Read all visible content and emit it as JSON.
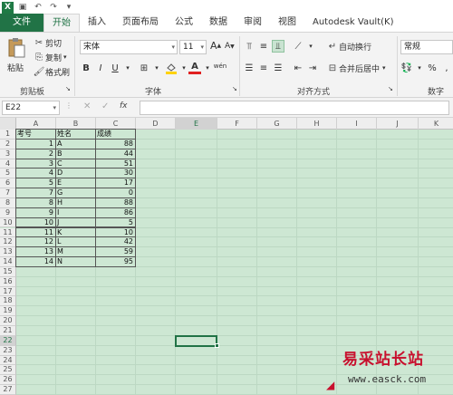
{
  "app": {
    "icon": "excel-app-icon",
    "accent": "#217346"
  },
  "quick_access": [
    {
      "name": "save-icon",
      "glyph": "▣"
    },
    {
      "name": "undo-icon",
      "glyph": "↶"
    },
    {
      "name": "redo-icon",
      "glyph": "↷"
    },
    {
      "name": "customize-qat-icon",
      "glyph": "▾"
    }
  ],
  "tabs": [
    "文件",
    "开始",
    "插入",
    "页面布局",
    "公式",
    "数据",
    "审阅",
    "视图",
    "Autodesk Vault(K)"
  ],
  "active_tab": "开始",
  "ribbon": {
    "clipboard": {
      "paste": "粘贴",
      "cut": "剪切",
      "copy": "复制",
      "format_painter": "格式刷",
      "group": "剪贴板"
    },
    "font": {
      "font_name": "宋体",
      "font_size": "11",
      "bold": "B",
      "italic": "I",
      "underline": "U",
      "font_color_letter": "A",
      "grow": "A",
      "shrink": "A",
      "wen": "wén",
      "group": "字体"
    },
    "alignment": {
      "wrap_text": "自动换行",
      "merge_center": "合并后居中",
      "group": "对齐方式"
    },
    "number": {
      "format": "常规",
      "percent": "%",
      "group": "数字"
    }
  },
  "formula_bar": {
    "name_box": "E22",
    "fx": "fx"
  },
  "columns": [
    "A",
    "B",
    "C",
    "D",
    "E",
    "F",
    "G",
    "H",
    "I",
    "J",
    "K"
  ],
  "rows": [
    "1",
    "2",
    "3",
    "4",
    "5",
    "6",
    "7",
    "8",
    "9",
    "10",
    "11",
    "12",
    "13",
    "14",
    "15",
    "16",
    "17",
    "18",
    "19",
    "20",
    "21",
    "22",
    "23",
    "24",
    "25",
    "26",
    "27"
  ],
  "table": {
    "headers": [
      "考号",
      "姓名",
      "成绩"
    ],
    "rows": [
      [
        "1",
        "A",
        "88"
      ],
      [
        "2",
        "B",
        "44"
      ],
      [
        "3",
        "C",
        "51"
      ],
      [
        "4",
        "D",
        "30"
      ],
      [
        "5",
        "E",
        "17"
      ],
      [
        "7",
        "G",
        "0"
      ],
      [
        "8",
        "H",
        "88"
      ],
      [
        "9",
        "I",
        "86"
      ],
      [
        "10",
        "J",
        "5"
      ],
      [
        "11",
        "K",
        "10"
      ],
      [
        "12",
        "L",
        "42"
      ],
      [
        "13",
        "M",
        "59"
      ],
      [
        "14",
        "N",
        "95"
      ]
    ]
  },
  "selected_cell": "E22",
  "watermark": {
    "title": "易采站长站",
    "url": "www.easck.com"
  }
}
